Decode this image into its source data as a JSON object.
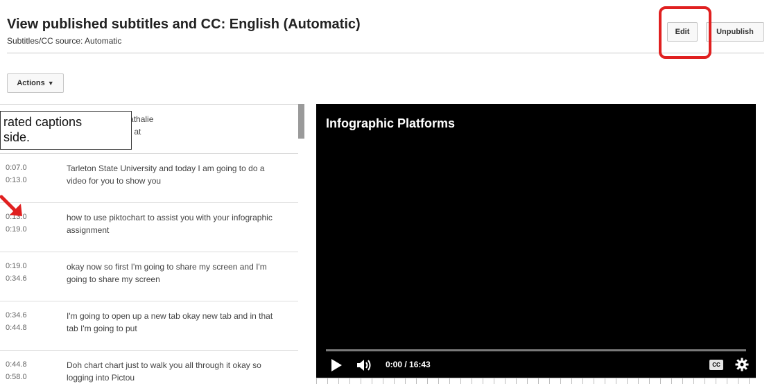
{
  "header": {
    "title": "View published subtitles and CC: English (Automatic)",
    "source_line": "Subtitles/CC source: Automatic",
    "edit_label": "Edit",
    "unpublish_label": "Unpublish"
  },
  "toolbar": {
    "actions_label": "Actions",
    "actions_icon": "caret-down-icon"
  },
  "annotation": {
    "line1": "rated captions",
    "line2": "side.",
    "highlight_color": "#e02020"
  },
  "captions": [
    {
      "start": "",
      "end": "",
      "text": "my name is dr. Nathalie\nssistant professor at"
    },
    {
      "start": "0:07.0",
      "end": "0:13.0",
      "text": "Tarleton State University and today I am going to do a video for you to show you"
    },
    {
      "start": "0:13.0",
      "end": "0:19.0",
      "text": "how to use piktochart to assist you with your infographic assignment"
    },
    {
      "start": "0:19.0",
      "end": "0:34.6",
      "text": "okay now so first I'm going to share my screen and I'm going to share my screen"
    },
    {
      "start": "0:34.6",
      "end": "0:44.8",
      "text": "I'm going to open up a new tab okay new tab and in that tab I'm going to put"
    },
    {
      "start": "0:44.8",
      "end": "0:58.0",
      "text": "Doh chart chart just to walk you all through it okay so logging into Pictou"
    }
  ],
  "video": {
    "title": "Infographic Platforms",
    "time": "0:00 / 16:43",
    "progress_fraction": 0,
    "cc_label": "CC",
    "icons": [
      "play-icon",
      "volume-icon",
      "cc-icon",
      "gear-icon"
    ]
  }
}
